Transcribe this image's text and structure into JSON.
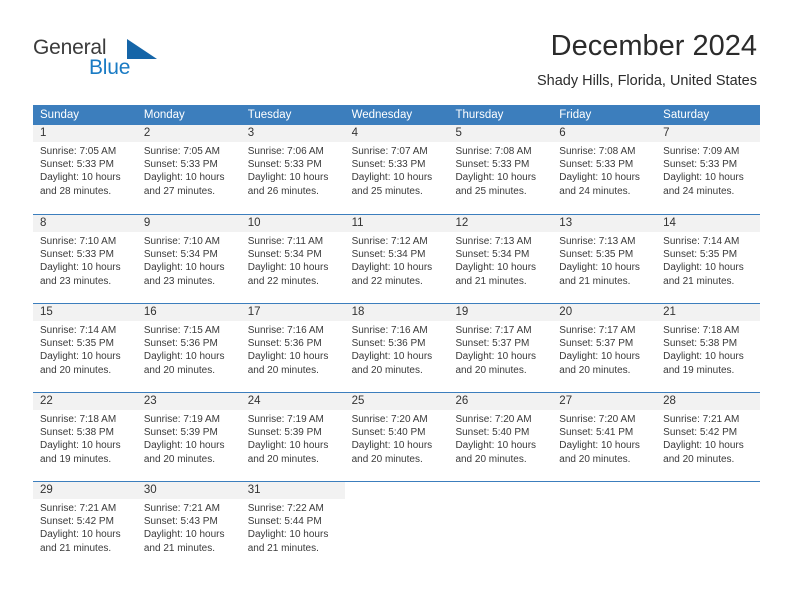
{
  "brand": {
    "name_part1": "General",
    "name_part2": "Blue",
    "triangle_icon": "triangle-logo-icon"
  },
  "header": {
    "title": "December 2024",
    "location": "Shady Hills, Florida, United States"
  },
  "weekdays": [
    "Sunday",
    "Monday",
    "Tuesday",
    "Wednesday",
    "Thursday",
    "Friday",
    "Saturday"
  ],
  "colors": {
    "header_blue": "#3c7ebd",
    "band_gray": "#f2f2f2",
    "brand_blue": "#1a7bc4",
    "text": "#333333"
  },
  "weeks": [
    [
      {
        "day": "1",
        "sunrise": "Sunrise: 7:05 AM",
        "sunset": "Sunset: 5:33 PM",
        "daylight1": "Daylight: 10 hours",
        "daylight2": "and 28 minutes."
      },
      {
        "day": "2",
        "sunrise": "Sunrise: 7:05 AM",
        "sunset": "Sunset: 5:33 PM",
        "daylight1": "Daylight: 10 hours",
        "daylight2": "and 27 minutes."
      },
      {
        "day": "3",
        "sunrise": "Sunrise: 7:06 AM",
        "sunset": "Sunset: 5:33 PM",
        "daylight1": "Daylight: 10 hours",
        "daylight2": "and 26 minutes."
      },
      {
        "day": "4",
        "sunrise": "Sunrise: 7:07 AM",
        "sunset": "Sunset: 5:33 PM",
        "daylight1": "Daylight: 10 hours",
        "daylight2": "and 25 minutes."
      },
      {
        "day": "5",
        "sunrise": "Sunrise: 7:08 AM",
        "sunset": "Sunset: 5:33 PM",
        "daylight1": "Daylight: 10 hours",
        "daylight2": "and 25 minutes."
      },
      {
        "day": "6",
        "sunrise": "Sunrise: 7:08 AM",
        "sunset": "Sunset: 5:33 PM",
        "daylight1": "Daylight: 10 hours",
        "daylight2": "and 24 minutes."
      },
      {
        "day": "7",
        "sunrise": "Sunrise: 7:09 AM",
        "sunset": "Sunset: 5:33 PM",
        "daylight1": "Daylight: 10 hours",
        "daylight2": "and 24 minutes."
      }
    ],
    [
      {
        "day": "8",
        "sunrise": "Sunrise: 7:10 AM",
        "sunset": "Sunset: 5:33 PM",
        "daylight1": "Daylight: 10 hours",
        "daylight2": "and 23 minutes."
      },
      {
        "day": "9",
        "sunrise": "Sunrise: 7:10 AM",
        "sunset": "Sunset: 5:34 PM",
        "daylight1": "Daylight: 10 hours",
        "daylight2": "and 23 minutes."
      },
      {
        "day": "10",
        "sunrise": "Sunrise: 7:11 AM",
        "sunset": "Sunset: 5:34 PM",
        "daylight1": "Daylight: 10 hours",
        "daylight2": "and 22 minutes."
      },
      {
        "day": "11",
        "sunrise": "Sunrise: 7:12 AM",
        "sunset": "Sunset: 5:34 PM",
        "daylight1": "Daylight: 10 hours",
        "daylight2": "and 22 minutes."
      },
      {
        "day": "12",
        "sunrise": "Sunrise: 7:13 AM",
        "sunset": "Sunset: 5:34 PM",
        "daylight1": "Daylight: 10 hours",
        "daylight2": "and 21 minutes."
      },
      {
        "day": "13",
        "sunrise": "Sunrise: 7:13 AM",
        "sunset": "Sunset: 5:35 PM",
        "daylight1": "Daylight: 10 hours",
        "daylight2": "and 21 minutes."
      },
      {
        "day": "14",
        "sunrise": "Sunrise: 7:14 AM",
        "sunset": "Sunset: 5:35 PM",
        "daylight1": "Daylight: 10 hours",
        "daylight2": "and 21 minutes."
      }
    ],
    [
      {
        "day": "15",
        "sunrise": "Sunrise: 7:14 AM",
        "sunset": "Sunset: 5:35 PM",
        "daylight1": "Daylight: 10 hours",
        "daylight2": "and 20 minutes."
      },
      {
        "day": "16",
        "sunrise": "Sunrise: 7:15 AM",
        "sunset": "Sunset: 5:36 PM",
        "daylight1": "Daylight: 10 hours",
        "daylight2": "and 20 minutes."
      },
      {
        "day": "17",
        "sunrise": "Sunrise: 7:16 AM",
        "sunset": "Sunset: 5:36 PM",
        "daylight1": "Daylight: 10 hours",
        "daylight2": "and 20 minutes."
      },
      {
        "day": "18",
        "sunrise": "Sunrise: 7:16 AM",
        "sunset": "Sunset: 5:36 PM",
        "daylight1": "Daylight: 10 hours",
        "daylight2": "and 20 minutes."
      },
      {
        "day": "19",
        "sunrise": "Sunrise: 7:17 AM",
        "sunset": "Sunset: 5:37 PM",
        "daylight1": "Daylight: 10 hours",
        "daylight2": "and 20 minutes."
      },
      {
        "day": "20",
        "sunrise": "Sunrise: 7:17 AM",
        "sunset": "Sunset: 5:37 PM",
        "daylight1": "Daylight: 10 hours",
        "daylight2": "and 20 minutes."
      },
      {
        "day": "21",
        "sunrise": "Sunrise: 7:18 AM",
        "sunset": "Sunset: 5:38 PM",
        "daylight1": "Daylight: 10 hours",
        "daylight2": "and 19 minutes."
      }
    ],
    [
      {
        "day": "22",
        "sunrise": "Sunrise: 7:18 AM",
        "sunset": "Sunset: 5:38 PM",
        "daylight1": "Daylight: 10 hours",
        "daylight2": "and 19 minutes."
      },
      {
        "day": "23",
        "sunrise": "Sunrise: 7:19 AM",
        "sunset": "Sunset: 5:39 PM",
        "daylight1": "Daylight: 10 hours",
        "daylight2": "and 20 minutes."
      },
      {
        "day": "24",
        "sunrise": "Sunrise: 7:19 AM",
        "sunset": "Sunset: 5:39 PM",
        "daylight1": "Daylight: 10 hours",
        "daylight2": "and 20 minutes."
      },
      {
        "day": "25",
        "sunrise": "Sunrise: 7:20 AM",
        "sunset": "Sunset: 5:40 PM",
        "daylight1": "Daylight: 10 hours",
        "daylight2": "and 20 minutes."
      },
      {
        "day": "26",
        "sunrise": "Sunrise: 7:20 AM",
        "sunset": "Sunset: 5:40 PM",
        "daylight1": "Daylight: 10 hours",
        "daylight2": "and 20 minutes."
      },
      {
        "day": "27",
        "sunrise": "Sunrise: 7:20 AM",
        "sunset": "Sunset: 5:41 PM",
        "daylight1": "Daylight: 10 hours",
        "daylight2": "and 20 minutes."
      },
      {
        "day": "28",
        "sunrise": "Sunrise: 7:21 AM",
        "sunset": "Sunset: 5:42 PM",
        "daylight1": "Daylight: 10 hours",
        "daylight2": "and 20 minutes."
      }
    ],
    [
      {
        "day": "29",
        "sunrise": "Sunrise: 7:21 AM",
        "sunset": "Sunset: 5:42 PM",
        "daylight1": "Daylight: 10 hours",
        "daylight2": "and 21 minutes."
      },
      {
        "day": "30",
        "sunrise": "Sunrise: 7:21 AM",
        "sunset": "Sunset: 5:43 PM",
        "daylight1": "Daylight: 10 hours",
        "daylight2": "and 21 minutes."
      },
      {
        "day": "31",
        "sunrise": "Sunrise: 7:22 AM",
        "sunset": "Sunset: 5:44 PM",
        "daylight1": "Daylight: 10 hours",
        "daylight2": "and 21 minutes."
      },
      {
        "day": "",
        "sunrise": "",
        "sunset": "",
        "daylight1": "",
        "daylight2": ""
      },
      {
        "day": "",
        "sunrise": "",
        "sunset": "",
        "daylight1": "",
        "daylight2": ""
      },
      {
        "day": "",
        "sunrise": "",
        "sunset": "",
        "daylight1": "",
        "daylight2": ""
      },
      {
        "day": "",
        "sunrise": "",
        "sunset": "",
        "daylight1": "",
        "daylight2": ""
      }
    ]
  ]
}
